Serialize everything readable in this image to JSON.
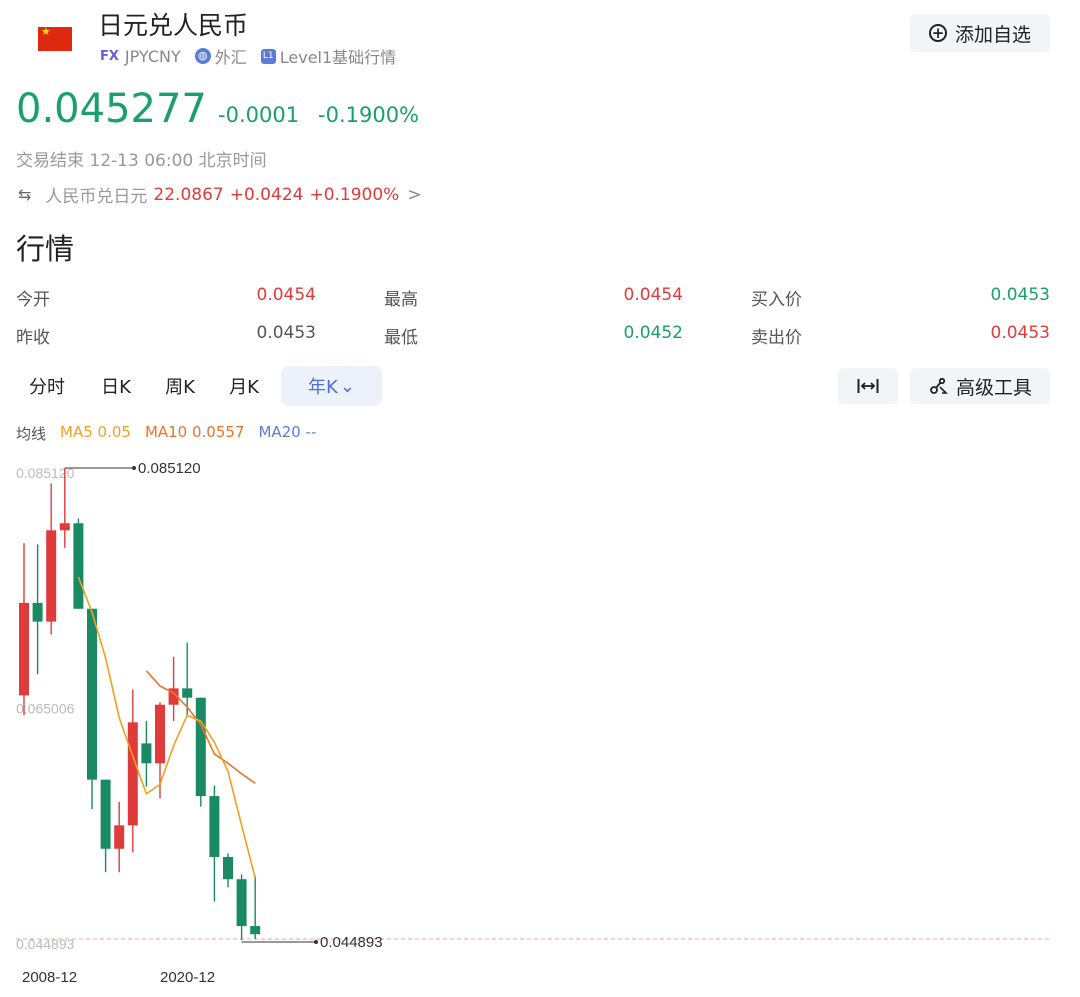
{
  "header": {
    "title": "日元兑人民币",
    "fx_badge": "FX",
    "symbol": "JPYCNY",
    "market": "外汇",
    "level_badge": "L1",
    "level": "Level1基础行情",
    "add_button": "添加自选",
    "flag_icon": "china-flag-icon"
  },
  "quote": {
    "price": "0.045277",
    "change": "-0.0001",
    "change_pct": "-0.1900%",
    "status": "交易结束 12-13 06:00 北京时间",
    "reverse_label": "人民币兑日元",
    "reverse_price": "22.0867",
    "reverse_change": "+0.0424",
    "reverse_pct": "+0.1900%",
    "reverse_arrow": ">"
  },
  "section_title": "行情",
  "stats": {
    "open_label": "今开",
    "open": "0.0454",
    "high_label": "最高",
    "high": "0.0454",
    "bid_label": "买入价",
    "bid": "0.0453",
    "prev_close_label": "昨收",
    "prev_close": "0.0453",
    "low_label": "最低",
    "low": "0.0452",
    "ask_label": "卖出价",
    "ask": "0.0453"
  },
  "tabs": {
    "intraday": "分时",
    "day": "日K",
    "week": "周K",
    "month": "月K",
    "year": "年K",
    "advanced": "高级工具"
  },
  "ma_legend": {
    "label": "均线",
    "ma5": "MA5 0.05",
    "ma10": "MA10 0.0557",
    "ma20": "MA20 --"
  },
  "colors": {
    "up": "#e03b3b",
    "down": "#1a8a64",
    "price_green": "#1aa06a",
    "ma5": "#f0a020",
    "ma10": "#e8742a",
    "ma20": "#5b7bd6",
    "accent": "#4a6fd6"
  },
  "chart_data": {
    "type": "candlestick",
    "period": "year",
    "y_axis_labels": [
      "0.085120",
      "0.065006",
      "0.044893"
    ],
    "ylim": [
      0.044893,
      0.08512
    ],
    "max_marker": "0.085120",
    "min_marker": "0.044893",
    "x_tick_labels": [
      "2008-12",
      "2020-12"
    ],
    "candles": [
      {
        "open": 0.0657,
        "close": 0.0736,
        "high": 0.0787,
        "low": 0.064
      },
      {
        "open": 0.0736,
        "close": 0.072,
        "high": 0.0786,
        "low": 0.0675
      },
      {
        "open": 0.072,
        "close": 0.0798,
        "high": 0.0838,
        "low": 0.0709
      },
      {
        "open": 0.0798,
        "close": 0.0804,
        "high": 0.0851,
        "low": 0.0783
      },
      {
        "open": 0.0804,
        "close": 0.0731,
        "high": 0.0808,
        "low": 0.0731
      },
      {
        "open": 0.0731,
        "close": 0.0585,
        "high": 0.0731,
        "low": 0.056
      },
      {
        "open": 0.0585,
        "close": 0.0526,
        "high": 0.0585,
        "low": 0.0506
      },
      {
        "open": 0.0526,
        "close": 0.0546,
        "high": 0.0566,
        "low": 0.0506
      },
      {
        "open": 0.0546,
        "close": 0.0634,
        "high": 0.0662,
        "low": 0.0523
      },
      {
        "open": 0.0616,
        "close": 0.0599,
        "high": 0.0635,
        "low": 0.0579
      },
      {
        "open": 0.0599,
        "close": 0.0649,
        "high": 0.0651,
        "low": 0.0569
      },
      {
        "open": 0.0649,
        "close": 0.0663,
        "high": 0.069,
        "low": 0.0635
      },
      {
        "open": 0.0663,
        "close": 0.0655,
        "high": 0.0702,
        "low": 0.064
      },
      {
        "open": 0.0655,
        "close": 0.0571,
        "high": 0.0655,
        "low": 0.0562
      },
      {
        "open": 0.0571,
        "close": 0.0519,
        "high": 0.058,
        "low": 0.0481
      },
      {
        "open": 0.0519,
        "close": 0.05,
        "high": 0.0522,
        "low": 0.0493
      },
      {
        "open": 0.05,
        "close": 0.046,
        "high": 0.0504,
        "low": 0.0448
      },
      {
        "open": 0.046,
        "close": 0.0453,
        "high": 0.0503,
        "low": 0.0449
      }
    ],
    "ma5": [
      null,
      null,
      null,
      null,
      0.0758,
      0.0728,
      0.0689,
      0.0638,
      0.0605,
      0.0573,
      0.0581,
      0.0614,
      0.064,
      0.0635,
      0.0617,
      0.0592,
      0.0546,
      0.0501
    ],
    "ma10": [
      null,
      null,
      null,
      null,
      null,
      null,
      null,
      null,
      null,
      0.0678,
      0.0665,
      0.0659,
      0.0647,
      0.0632,
      0.0607,
      0.0599,
      0.059,
      0.0582
    ]
  }
}
